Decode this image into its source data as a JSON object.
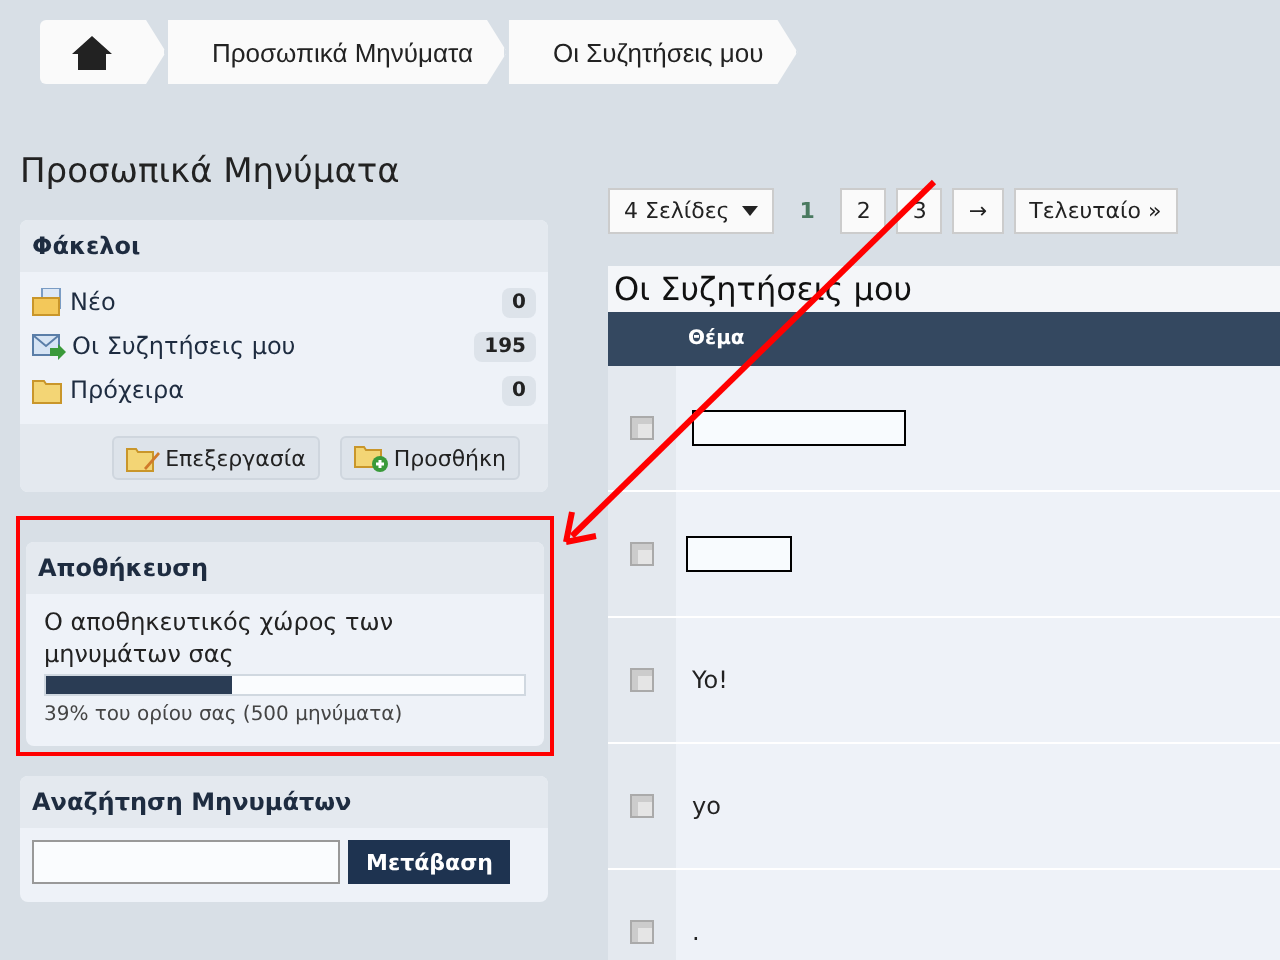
{
  "breadcrumb": [
    "Προσωπικά Μηνύματα",
    "Οι Συζητήσεις μου"
  ],
  "page_title": "Προσωπικά Μηνύματα",
  "folders": {
    "title": "Φάκελοι",
    "items": [
      {
        "kind": "new",
        "label": "Νέο",
        "count": "0"
      },
      {
        "kind": "inbox",
        "label": "Οι Συζητήσεις μου",
        "count": "195"
      },
      {
        "kind": "drafts",
        "label": "Πρόχειρα",
        "count": "0"
      }
    ],
    "buttons": [
      {
        "kind": "edit",
        "label": "Επεξεργασία"
      },
      {
        "kind": "add",
        "label": "Προσθήκη"
      }
    ]
  },
  "storage": {
    "title": "Αποθήκευση",
    "description": "Ο αποθηκευτικός χώρος των μηνυμάτων σας",
    "level": 0.39,
    "note": "39% του ορίου σας (500 μηνύματα)",
    "highlighted": true
  },
  "search": {
    "title": "Αναζήτηση Μηνυμάτων",
    "button": "Μετάβαση"
  },
  "pagination": {
    "pages_menu": "4 Σελίδες",
    "pages": [
      {
        "label": "1",
        "selected": true
      },
      {
        "label": "2",
        "selected": false
      },
      {
        "label": "3",
        "selected": false
      }
    ],
    "next": "→",
    "last": "Τελευταίο »"
  },
  "conversations": {
    "title": "Οι Συζητήσεις μου",
    "column_header": "Θέμα",
    "rows": [
      {
        "kind": "redacted",
        "subject": ""
      },
      {
        "kind": "redacted",
        "subject": ""
      },
      {
        "kind": "text",
        "subject": "Yo!"
      },
      {
        "kind": "text",
        "subject": "yo"
      },
      {
        "kind": "text",
        "subject": "."
      }
    ]
  },
  "annotation_arrow": true
}
